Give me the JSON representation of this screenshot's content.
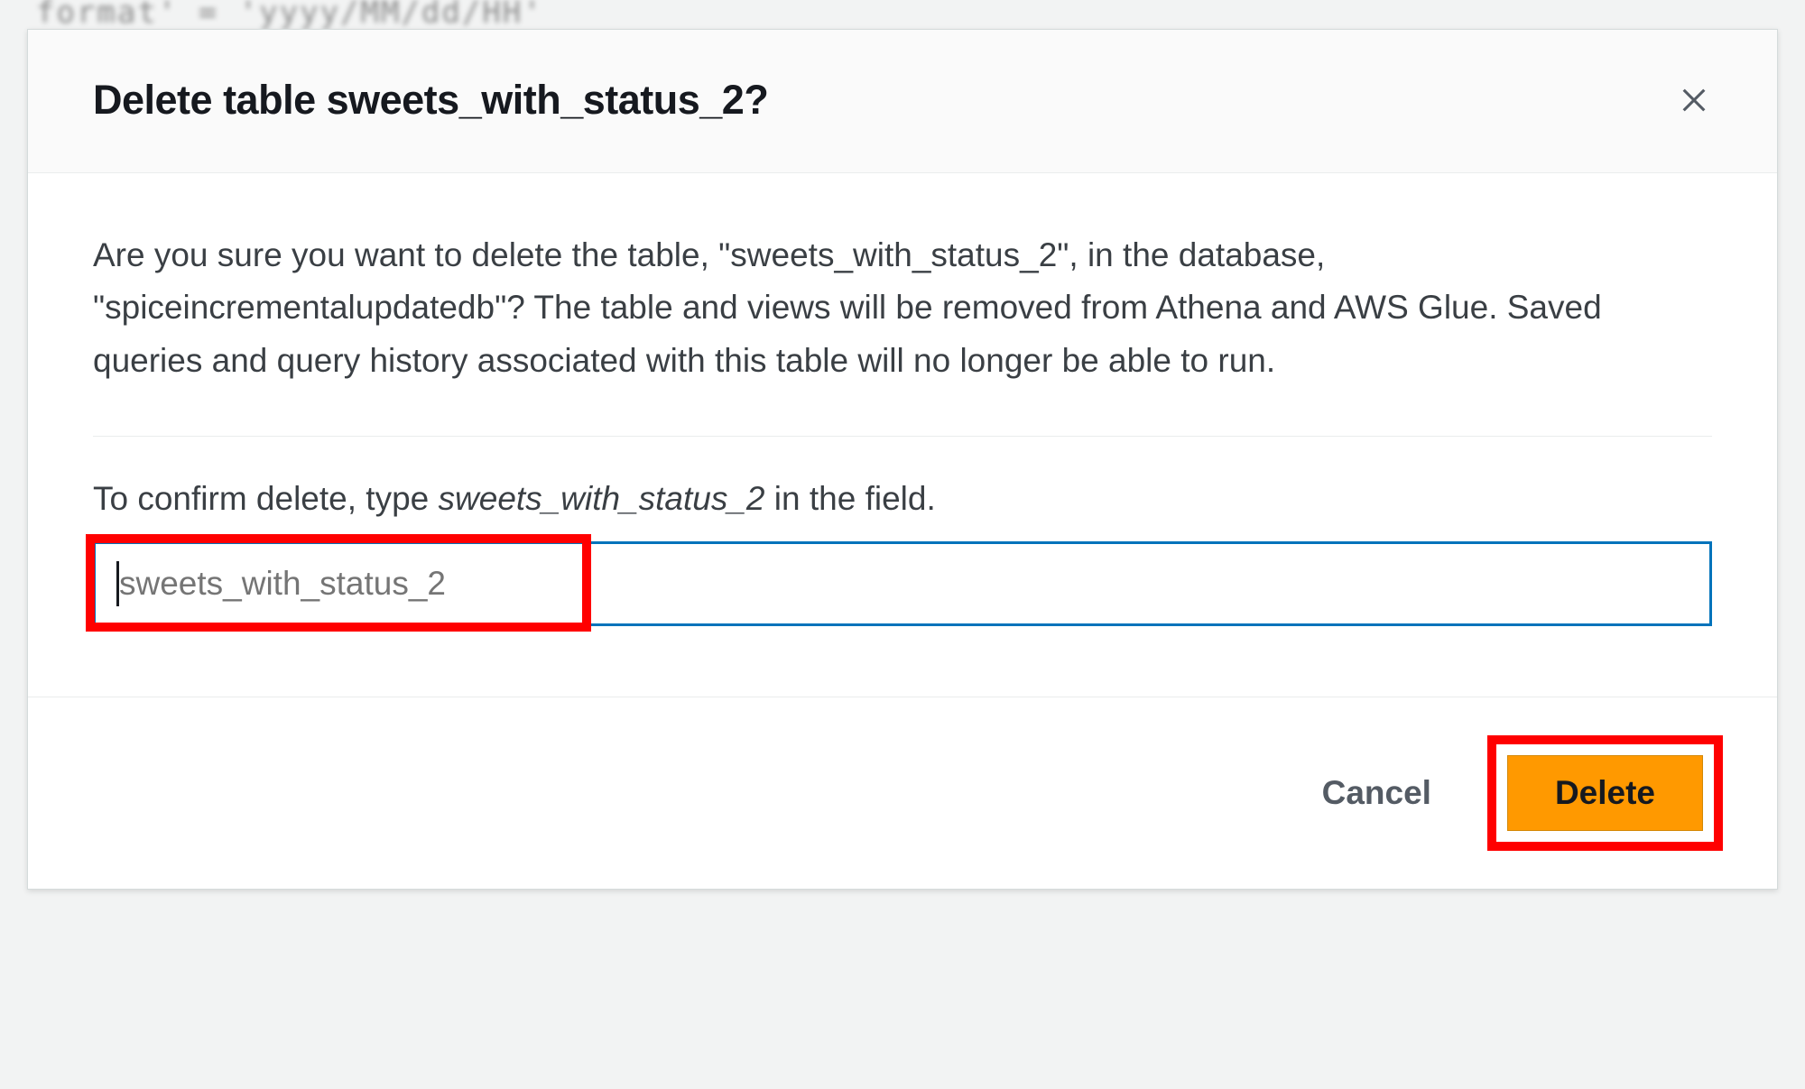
{
  "background": {
    "code_fragment": "format' = 'yyyy/MM/dd/HH'"
  },
  "modal": {
    "title": "Delete table sweets_with_status_2?",
    "warning": "Are you sure you want to delete the table, \"sweets_with_status_2\", in the database, \"spiceincrementalupdatedb\"? The table and views will be removed from Athena and AWS Glue. Saved queries and query history associated with this table will no longer be able to run.",
    "confirm_prefix": "To confirm delete, type ",
    "confirm_table_name": "sweets_with_status_2",
    "confirm_suffix": " in the field.",
    "input": {
      "placeholder": "sweets_with_status_2",
      "value": ""
    },
    "buttons": {
      "cancel": "Cancel",
      "delete": "Delete"
    }
  }
}
